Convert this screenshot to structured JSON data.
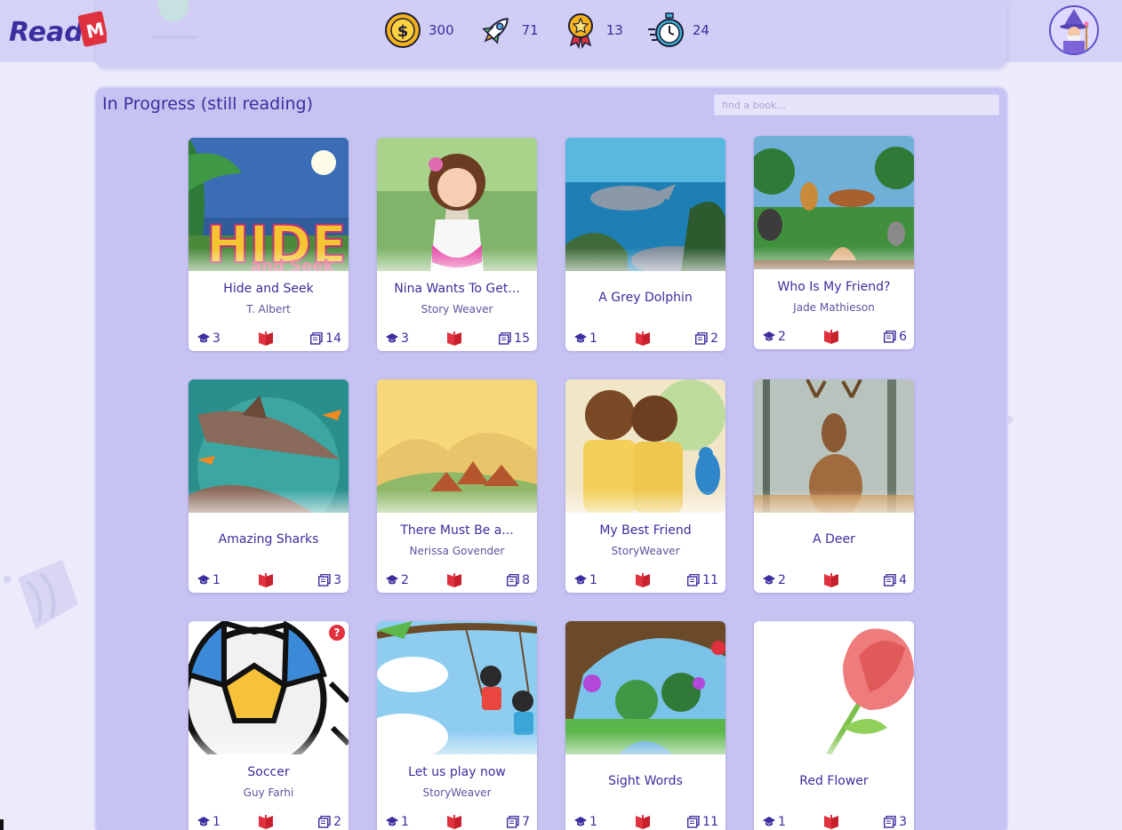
{
  "header": {
    "logo_text": "Read",
    "logo_badge": "M",
    "stats": [
      {
        "icon": "coin-icon",
        "value": "300"
      },
      {
        "icon": "rocket-icon",
        "value": "71"
      },
      {
        "icon": "medal-icon",
        "value": "13"
      },
      {
        "icon": "stopwatch-icon",
        "value": "24"
      }
    ],
    "avatar_icon": "wizard-avatar-icon"
  },
  "panel": {
    "title": "In Progress (still reading)",
    "search_placeholder": "find a book..."
  },
  "colors": {
    "accent": "#3b2e9e",
    "panel_bg": "#c6c3f2",
    "book_icon": "#e0323e"
  },
  "books": [
    {
      "title": "Hide and Seek",
      "author": "T. Albert",
      "level": "3",
      "pages": "14",
      "cover": "hide-and-seek-cover"
    },
    {
      "title": "Nina Wants To Get...",
      "author": "Story Weaver",
      "level": "3",
      "pages": "15",
      "cover": "girl-doctor-cover"
    },
    {
      "title": "A Grey Dolphin",
      "author": "",
      "level": "1",
      "pages": "2",
      "cover": "dolphin-cover"
    },
    {
      "title": "Who Is My Friend?",
      "author": "Jade Mathieson",
      "level": "2",
      "pages": "6",
      "cover": "animals-cover"
    },
    {
      "title": "Amazing Sharks",
      "author": "",
      "level": "1",
      "pages": "3",
      "cover": "sharks-cover"
    },
    {
      "title": "There Must Be a...",
      "author": "Nerissa Govender",
      "level": "2",
      "pages": "8",
      "cover": "village-cover"
    },
    {
      "title": "My Best Friend",
      "author": "StoryWeaver",
      "level": "1",
      "pages": "11",
      "cover": "friends-cover"
    },
    {
      "title": "A Deer",
      "author": "",
      "level": "2",
      "pages": "4",
      "cover": "deer-cover"
    },
    {
      "title": "Soccer",
      "author": "Guy Farhi",
      "level": "1",
      "pages": "2",
      "cover": "soccer-ball-cover",
      "badge": "?"
    },
    {
      "title": "Let us play now",
      "author": "StoryWeaver",
      "level": "1",
      "pages": "7",
      "cover": "swing-cover"
    },
    {
      "title": "Sight Words",
      "author": "",
      "level": "1",
      "pages": "11",
      "cover": "forest-arch-cover"
    },
    {
      "title": "Red Flower",
      "author": "",
      "level": "1",
      "pages": "3",
      "cover": "red-flower-cover"
    }
  ]
}
